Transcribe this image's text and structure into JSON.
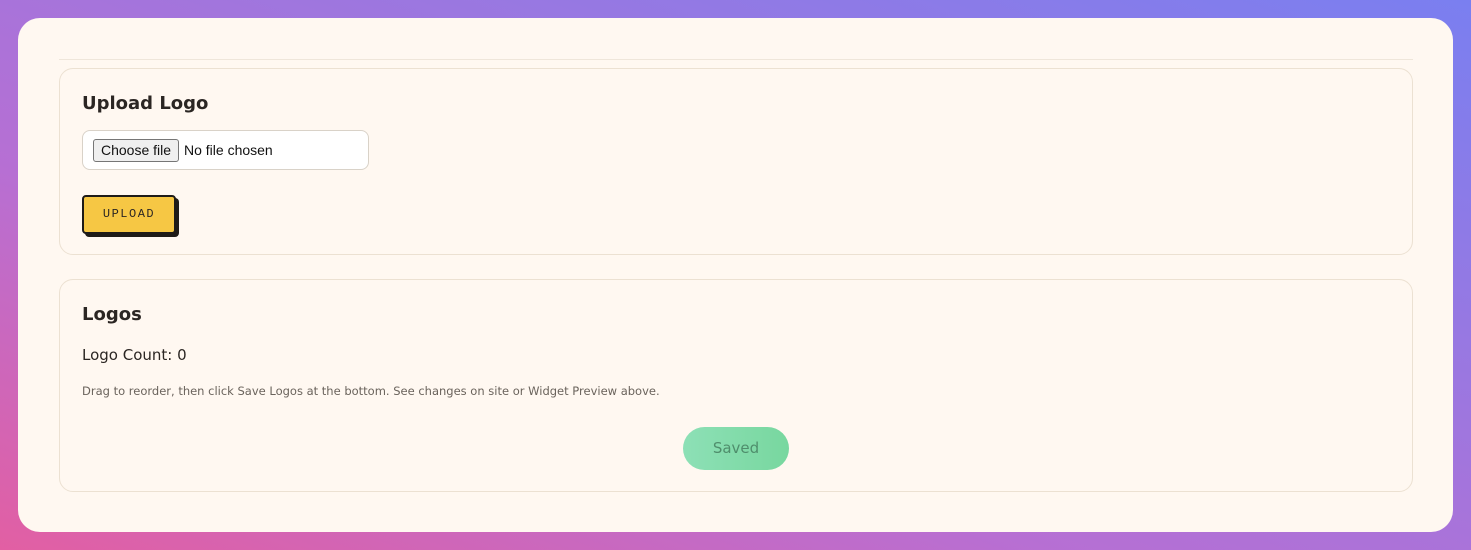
{
  "upload_section": {
    "title": "Upload Logo",
    "choose_file_label": "Choose file",
    "file_status": "No file chosen",
    "upload_label": "UPLOAD"
  },
  "logos_section": {
    "title": "Logos",
    "count_text": "Logo Count: 0",
    "hint": "Drag to reorder, then click Save Logos at the bottom. See changes on site or Widget Preview above.",
    "saved_label": "Saved"
  },
  "colors": {
    "card_background": "#fff8f1",
    "upload_button": "#f6c744",
    "saved_button": "#82dbaa"
  }
}
